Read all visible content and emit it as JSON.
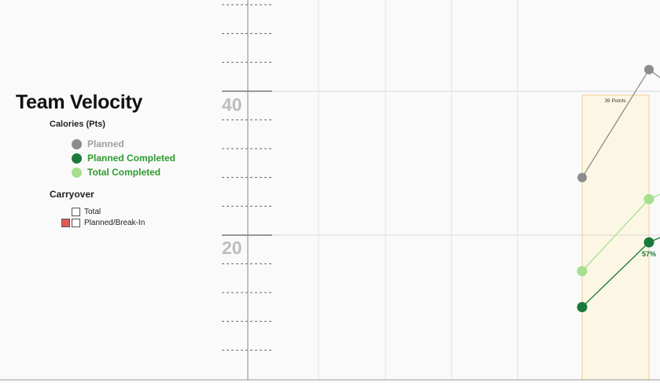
{
  "chart_data": {
    "type": "line",
    "title": "Team Velocity",
    "y_ticks": [
      "40",
      "20"
    ],
    "ylim": [
      0,
      52
    ],
    "grid": true,
    "legend_title": "Calories (Pts)",
    "series": [
      {
        "name": "Planned",
        "color": "#8c8c8c",
        "x": [
          0,
          1
        ],
        "values": [
          28,
          43
        ]
      },
      {
        "name": "Planned Completed",
        "color": "#1a7a3a",
        "x": [
          0,
          1
        ],
        "values": [
          10,
          19
        ]
      },
      {
        "name": "Total Completed",
        "color": "#a6e08f",
        "x": [
          0,
          1
        ],
        "values": [
          15,
          25
        ]
      }
    ],
    "annotations": [
      "39 Points",
      "57%"
    ]
  },
  "carryover": {
    "title": "Carryover",
    "items": [
      {
        "label": "Total"
      },
      {
        "label": "Planned/Break-In",
        "swatch_color": "#e05a5a"
      }
    ]
  }
}
